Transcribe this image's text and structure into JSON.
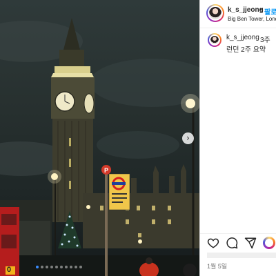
{
  "post": {
    "username": "k_s_jjeong",
    "separator": "•",
    "follow_label": "팔로",
    "location": "Big Ben Tower, Lond",
    "caption_username": "k_s_jjeong",
    "caption_time": "3주",
    "caption_text": "런던 2주 요약",
    "date": "1월 5일"
  },
  "photo": {
    "bus_number": "0",
    "carousel_dots": 10,
    "active_dot": 0
  },
  "icons": {
    "next": "chevron-right-icon",
    "like": "heart-icon",
    "comment": "comment-icon",
    "share": "send-icon",
    "emoji": "emoji-icon"
  },
  "colors": {
    "follow": "#0095f6",
    "clock_glow": "#efe9c8",
    "tower": "#4a4934",
    "sky": "#2b3434"
  }
}
